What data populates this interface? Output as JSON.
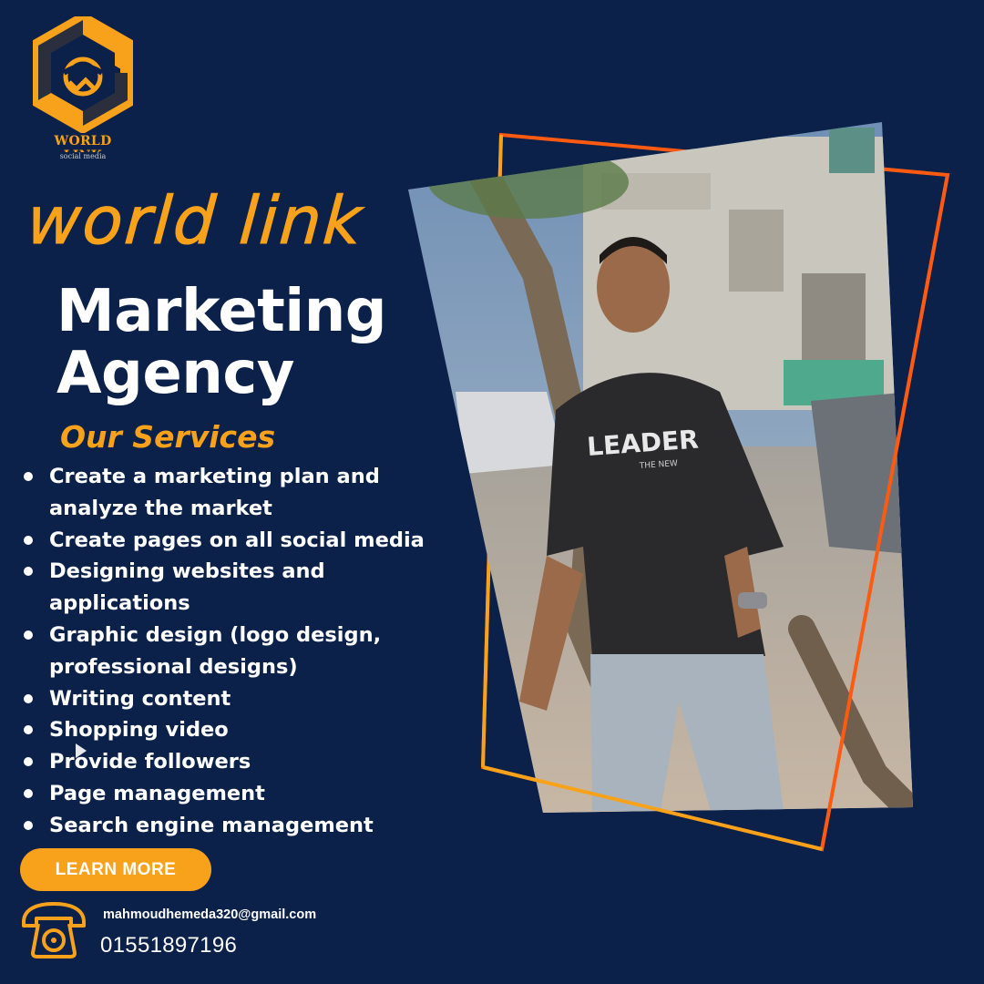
{
  "brand": {
    "logo_name": "WORLD LINK",
    "logo_sub": "social media"
  },
  "script_title": "world  link",
  "headline": {
    "line1": "Marketing",
    "line2": "Agency"
  },
  "services_title": "Our Services",
  "services": [
    {
      "text": "Create a marketing plan and analyze the market"
    },
    {
      "text": "Create pages on all social media"
    },
    {
      "text": "Designing websites and applications"
    },
    {
      "text": "Graphic design (logo design, professional designs)"
    },
    {
      "text": "Writing content"
    },
    {
      "text": "Shopping video"
    },
    {
      "text": "Provide followers"
    },
    {
      "text": "Page management"
    },
    {
      "text": "Search engine management"
    }
  ],
  "cta": {
    "label": "LEARN MORE"
  },
  "contact": {
    "email": "mahmoudhemeda320@gmail.com",
    "phone": "01551897196"
  },
  "photo": {
    "shirt_text": "LEADER",
    "shirt_subtext": "THE NEW"
  },
  "colors": {
    "background": "#0c2149",
    "accent_orange": "#f8a21c",
    "frame_orange": "#ff5a12",
    "text": "#ffffff"
  }
}
